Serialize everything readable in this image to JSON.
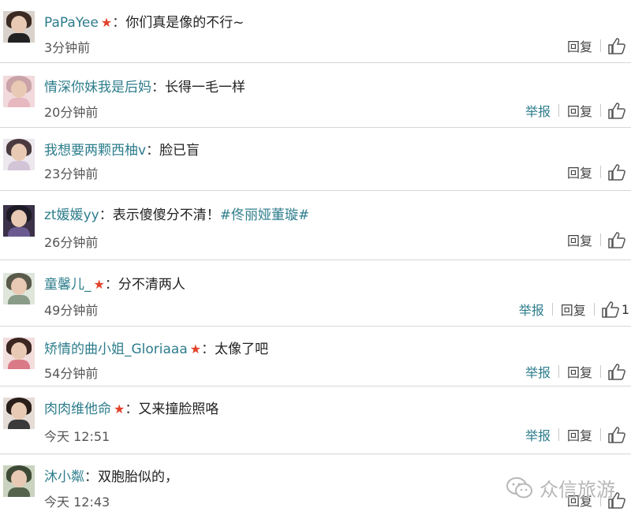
{
  "comments": [
    {
      "user": "PaPaYee",
      "star": true,
      "text": "你们真是像的不行~",
      "time": "3分钟前",
      "report": "",
      "reply": "回复",
      "likes": ""
    },
    {
      "user": "情深你妹我是后妈",
      "star": false,
      "text": "长得一毛一样",
      "time": "20分钟前",
      "report": "举报",
      "reply": "回复",
      "likes": ""
    },
    {
      "user": "我想要两颗西柚v",
      "star": false,
      "text": "脸已盲",
      "time": "23分钟前",
      "report": "",
      "reply": "回复",
      "likes": ""
    },
    {
      "user": "zt媛媛yy",
      "star": false,
      "text": "表示傻傻分不清！",
      "tag": "#佟丽娅董璇#",
      "time": "26分钟前",
      "report": "",
      "reply": "回复",
      "likes": ""
    },
    {
      "user": "童馨儿_",
      "star": true,
      "text": "分不清两人",
      "time": "49分钟前",
      "report": "举报",
      "reply": "回复",
      "likes": "1"
    },
    {
      "user": "矫情的曲小姐_Gloriaaa",
      "star": true,
      "text": "太像了吧",
      "time": "54分钟前",
      "report": "举报",
      "reply": "回复",
      "likes": ""
    },
    {
      "user": "肉肉维他命",
      "star": true,
      "text": "又来撞脸照咯",
      "time": "今天 12:51",
      "report": "举报",
      "reply": "回复",
      "likes": ""
    },
    {
      "user": "沐小粼",
      "star": false,
      "text": "双胞胎似的，",
      "time": "今天 12:43",
      "report": "",
      "reply": "回复",
      "likes": ""
    }
  ],
  "separator": "：",
  "watermark": "众信旅游",
  "colors": {
    "username": "#2d7d8c",
    "star": "#e2412b",
    "divider": "#d7d7d7"
  }
}
